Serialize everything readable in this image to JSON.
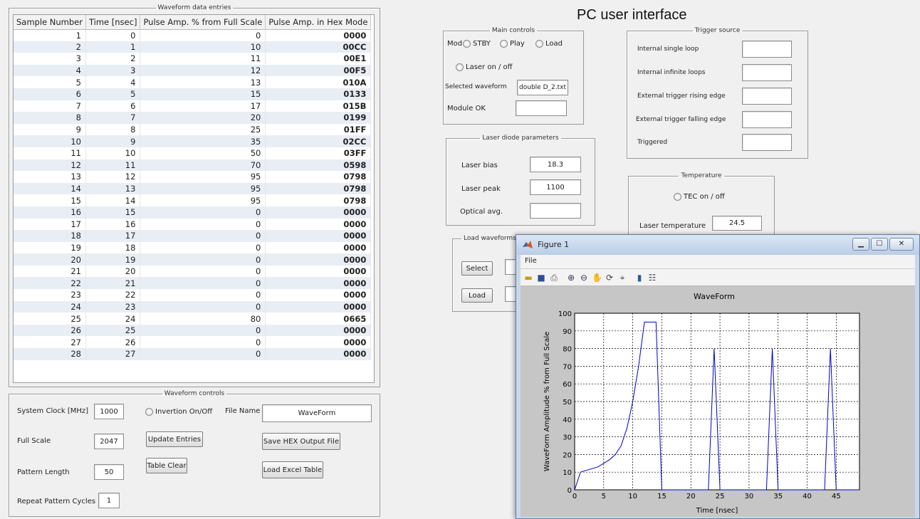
{
  "app": {
    "title": "PC user interface"
  },
  "table_panel": {
    "legend": "Waveform data entries",
    "columns": [
      "Sample Number",
      "Time [nsec]",
      "Pulse Amp. % from Full Scale",
      "Pulse Amp. in Hex Mode"
    ],
    "rows": [
      [
        "1",
        "0",
        "0",
        "0000"
      ],
      [
        "2",
        "1",
        "10",
        "00CC"
      ],
      [
        "3",
        "2",
        "11",
        "00E1"
      ],
      [
        "4",
        "3",
        "12",
        "00F5"
      ],
      [
        "5",
        "4",
        "13",
        "010A"
      ],
      [
        "6",
        "5",
        "15",
        "0133"
      ],
      [
        "7",
        "6",
        "17",
        "015B"
      ],
      [
        "8",
        "7",
        "20",
        "0199"
      ],
      [
        "9",
        "8",
        "25",
        "01FF"
      ],
      [
        "10",
        "9",
        "35",
        "02CC"
      ],
      [
        "11",
        "10",
        "50",
        "03FF"
      ],
      [
        "12",
        "11",
        "70",
        "0598"
      ],
      [
        "13",
        "12",
        "95",
        "0798"
      ],
      [
        "14",
        "13",
        "95",
        "0798"
      ],
      [
        "15",
        "14",
        "95",
        "0798"
      ],
      [
        "16",
        "15",
        "0",
        "0000"
      ],
      [
        "17",
        "16",
        "0",
        "0000"
      ],
      [
        "18",
        "17",
        "0",
        "0000"
      ],
      [
        "19",
        "18",
        "0",
        "0000"
      ],
      [
        "20",
        "19",
        "0",
        "0000"
      ],
      [
        "21",
        "20",
        "0",
        "0000"
      ],
      [
        "22",
        "21",
        "0",
        "0000"
      ],
      [
        "23",
        "22",
        "0",
        "0000"
      ],
      [
        "24",
        "23",
        "0",
        "0000"
      ],
      [
        "25",
        "24",
        "80",
        "0665"
      ],
      [
        "26",
        "25",
        "0",
        "0000"
      ],
      [
        "27",
        "26",
        "0",
        "0000"
      ],
      [
        "28",
        "27",
        "0",
        "0000"
      ]
    ]
  },
  "waveform_controls": {
    "legend": "Waveform controls",
    "system_clock_label": "System Clock [MHz]",
    "system_clock_value": "1000",
    "full_scale_label": "Full Scale",
    "full_scale_value": "2047",
    "pattern_length_label": "Pattern Length",
    "pattern_length_value": "50",
    "repeat_label": "Repeat Pattern Cycles",
    "repeat_value": "1",
    "inversion_label": "Invertion On/Off",
    "update_button": "Update Entries",
    "table_clear_button": "Table Clear",
    "file_name_label": "File Name",
    "file_name_value": "WaveForm",
    "save_hex_button": "Save HEX Output File",
    "load_excel_button": "Load Excel Table"
  },
  "main_controls": {
    "legend": "Main controls",
    "mod_label": "Mod",
    "radios": [
      "STBY",
      "Play",
      "Load"
    ],
    "laser_toggle": "Laser on / off",
    "selected_waveform_label": "Selected waveform",
    "selected_waveform_value": "double D_2.txt",
    "module_ok_label": "Module OK",
    "module_ok_value": ""
  },
  "trigger": {
    "legend": "Trigger source",
    "items": [
      "Internal single loop",
      "Internal infinite loops",
      "External trigger rising edge",
      "External trigger falling edge",
      "Triggered"
    ]
  },
  "laser_diode": {
    "legend": "Laser diode parameters",
    "bias_label": "Laser bias",
    "bias_value": "18.3",
    "peak_label": "Laser peak",
    "peak_value": "1100",
    "optical_label": "Optical avg.",
    "optical_value": ""
  },
  "temperature": {
    "legend": "Temperature",
    "tec_label": "TEC on / off",
    "laser_temp_label": "Laser temperature",
    "laser_temp_value": "24.5"
  },
  "load_waveform": {
    "legend": "Load waveforms",
    "select_button": "Select",
    "load_button": "Load"
  },
  "figure": {
    "title": "Figure 1",
    "menu_file": "File",
    "tools": [
      "open-icon",
      "save-icon",
      "print-icon",
      "zoom-in-icon",
      "zoom-out-icon",
      "pan-icon",
      "rotate-icon",
      "datacursor-icon",
      "colorbar-icon",
      "legend-icon"
    ]
  },
  "chart_data": {
    "type": "line",
    "title": "WaveForm",
    "xlabel": "Time [nsec]",
    "ylabel": "WaveForm Amplitude % from Full Scale",
    "xlim": [
      0,
      49
    ],
    "ylim": [
      0,
      100
    ],
    "xticks": [
      0,
      5,
      10,
      15,
      20,
      25,
      30,
      35,
      40,
      45
    ],
    "yticks": [
      0,
      10,
      20,
      30,
      40,
      50,
      60,
      70,
      80,
      90,
      100
    ],
    "grid": true,
    "color": "#0000cc",
    "x": [
      0,
      1,
      2,
      3,
      4,
      5,
      6,
      7,
      8,
      9,
      10,
      11,
      12,
      13,
      14,
      15,
      16,
      17,
      18,
      19,
      20,
      21,
      22,
      23,
      24,
      25,
      26,
      27,
      28,
      29,
      30,
      31,
      32,
      33,
      34,
      35,
      36,
      37,
      38,
      39,
      40,
      41,
      42,
      43,
      44,
      45,
      46,
      47,
      48,
      49
    ],
    "y": [
      0,
      10,
      11,
      12,
      13,
      15,
      17,
      20,
      25,
      35,
      50,
      70,
      95,
      95,
      95,
      0,
      0,
      0,
      0,
      0,
      0,
      0,
      0,
      0,
      80,
      0,
      0,
      0,
      0,
      0,
      0,
      0,
      0,
      0,
      80,
      0,
      0,
      0,
      0,
      0,
      0,
      0,
      0,
      0,
      80,
      0,
      0,
      0,
      0,
      0
    ]
  }
}
